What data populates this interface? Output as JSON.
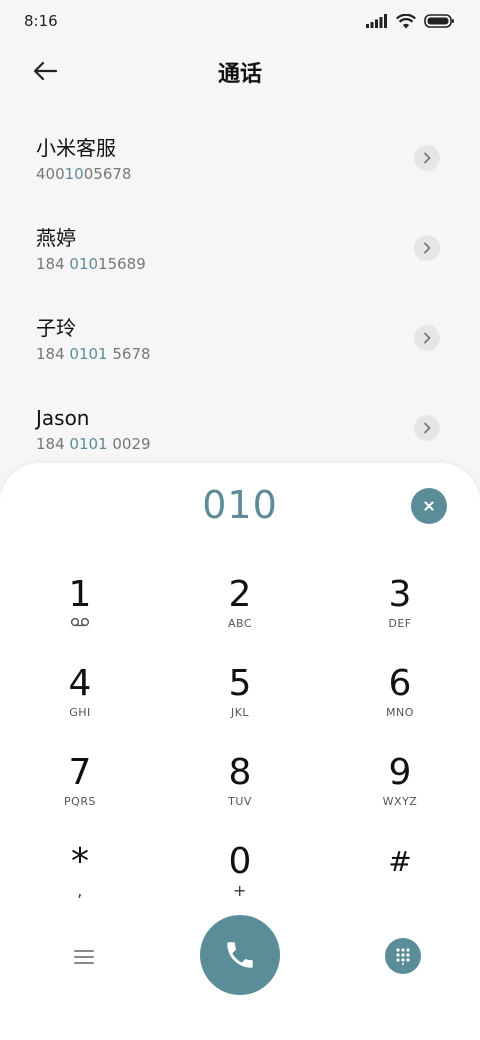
{
  "status_bar": {
    "time": "8:16"
  },
  "header": {
    "title": "通话"
  },
  "contacts": [
    {
      "name": "小米客服",
      "number_before": "400",
      "number_match": "10",
      "number_after": "05678"
    },
    {
      "name": "燕婷",
      "number_before": "184 ",
      "number_match": "010",
      "number_after": "15689"
    },
    {
      "name": "子玲",
      "number_before": "184 ",
      "number_match": "0101",
      "number_after": " 5678"
    },
    {
      "name": "Jason",
      "number_before": "184 ",
      "number_match": "0101",
      "number_after": " 0029"
    }
  ],
  "dialer": {
    "input": "010",
    "keys": [
      {
        "digit": "1",
        "letters": ""
      },
      {
        "digit": "2",
        "letters": "ABC"
      },
      {
        "digit": "3",
        "letters": "DEF"
      },
      {
        "digit": "4",
        "letters": "GHI"
      },
      {
        "digit": "5",
        "letters": "JKL"
      },
      {
        "digit": "6",
        "letters": "MNO"
      },
      {
        "digit": "7",
        "letters": "PQRS"
      },
      {
        "digit": "8",
        "letters": "TUV"
      },
      {
        "digit": "9",
        "letters": "WXYZ"
      },
      {
        "digit": "*",
        "letters": ","
      },
      {
        "digit": "0",
        "letters": "+"
      },
      {
        "digit": "#",
        "letters": ""
      }
    ]
  },
  "icons": {
    "back": "arrow-left-icon",
    "chevron": "chevron-right-icon",
    "clear": "close-icon",
    "voicemail": "voicemail-icon",
    "menu": "menu-icon",
    "call": "phone-icon",
    "dialpad": "dialpad-icon"
  },
  "colors": {
    "accent": "#5b8d98",
    "background": "#f6f6f6",
    "panel": "#ffffff"
  }
}
